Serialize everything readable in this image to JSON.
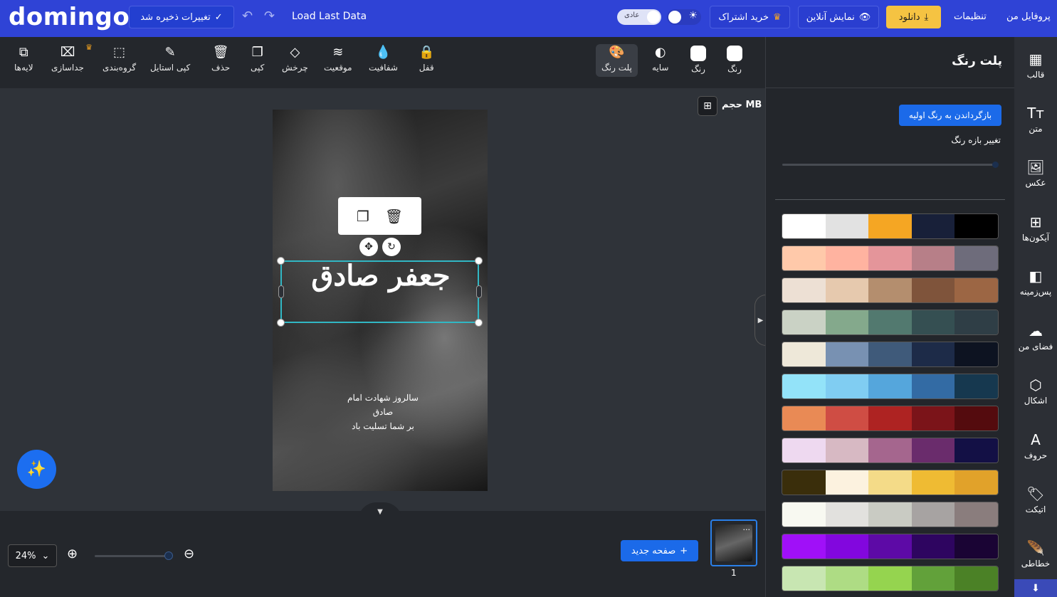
{
  "header": {
    "logo": "domingo",
    "saved_label": "تغییرات ذخیره شد",
    "load_last": "Load Last Data",
    "mode_label": "عادی",
    "subscribe_label": "خرید اشتراک",
    "preview_label": "نمایش آنلاین",
    "download_label": "دانلود",
    "settings_label": "تنظیمات",
    "profile_label": "پروفایل من"
  },
  "toolbar": {
    "layers": "لایه‌ها",
    "detach": "جداسازی",
    "group": "گروه‌بندی",
    "copy_style": "کپی استایل",
    "delete": "حذف",
    "copy": "کپی",
    "rotate": "چرخش",
    "position": "موقعیت",
    "opacity": "شفافیت",
    "lock": "قفل",
    "palette": "پلت رنگ",
    "shadow": "سایه",
    "color1": "رنگ",
    "color2": "رنگ"
  },
  "canvas": {
    "size_label": "حجم MB",
    "calligraphy_main": "جعفر صادق",
    "calligraphy_sub_line1": "سالروز شهادت امام صادق",
    "calligraphy_sub_line2": "بر شما تسلیت باد"
  },
  "bottom": {
    "zoom": "24%",
    "new_page": "صفحه جدید",
    "page_number": "1",
    "thumb_menu": "..."
  },
  "panel": {
    "title": "پلت رنگ",
    "reset_label": "بازگرداندن به رنگ اولیه",
    "range_label": "تغییر بازه رنگ",
    "palettes": [
      [
        "#ffffff",
        "#e2e2e2",
        "#f5a623",
        "#182039",
        "#000000"
      ],
      [
        "#ffc9aa",
        "#ffb3a0",
        "#e4959a",
        "#b77f88",
        "#6e6c7b"
      ],
      [
        "#ede0d4",
        "#e6c9ae",
        "#b48e6e",
        "#7f543b",
        "#9c6644"
      ],
      [
        "#cad2c5",
        "#84a98c",
        "#52796f",
        "#354f52",
        "#2f3e46"
      ],
      [
        "#eee8d9",
        "#7891b2",
        "#3f5a7a",
        "#1d2b48",
        "#0d1321"
      ],
      [
        "#93e3f9",
        "#80cdf2",
        "#55a6dc",
        "#336ba4",
        "#16384f"
      ],
      [
        "#e98a55",
        "#cf4d44",
        "#ae2322",
        "#7b1419",
        "#540b0e"
      ],
      [
        "#eed9f0",
        "#d7b9c3",
        "#a5668e",
        "#6a2c6c",
        "#131045"
      ],
      [
        "#3a2e0b",
        "#fcf2df",
        "#f4db88",
        "#efbb33",
        "#e1a22a"
      ],
      [
        "#f8f9f1",
        "#e2e1de",
        "#c9cbc3",
        "#a7a3a2",
        "#8a7d7d"
      ],
      [
        "#a010f8",
        "#8207de",
        "#5d0aa6",
        "#2e0560",
        "#1a0434"
      ],
      [
        "#c8e6b2",
        "#aedc84",
        "#95d44f",
        "#62a13a",
        "#4b8126"
      ]
    ]
  },
  "sidebar": {
    "items": [
      {
        "label": "قالب",
        "icon": "template-icon"
      },
      {
        "label": "متن",
        "icon": "text-icon"
      },
      {
        "label": "عکس",
        "icon": "image-icon"
      },
      {
        "label": "آیکون‌ها",
        "icon": "icons-icon"
      },
      {
        "label": "پس‌زمینه",
        "icon": "background-icon"
      },
      {
        "label": "فضای من",
        "icon": "upload-icon"
      },
      {
        "label": "اشکال",
        "icon": "shapes-icon"
      },
      {
        "label": "حروف",
        "icon": "letters-icon"
      },
      {
        "label": "اتیکت",
        "icon": "sticker-icon"
      },
      {
        "label": "خطاطی",
        "icon": "calligraphy-icon"
      }
    ]
  }
}
